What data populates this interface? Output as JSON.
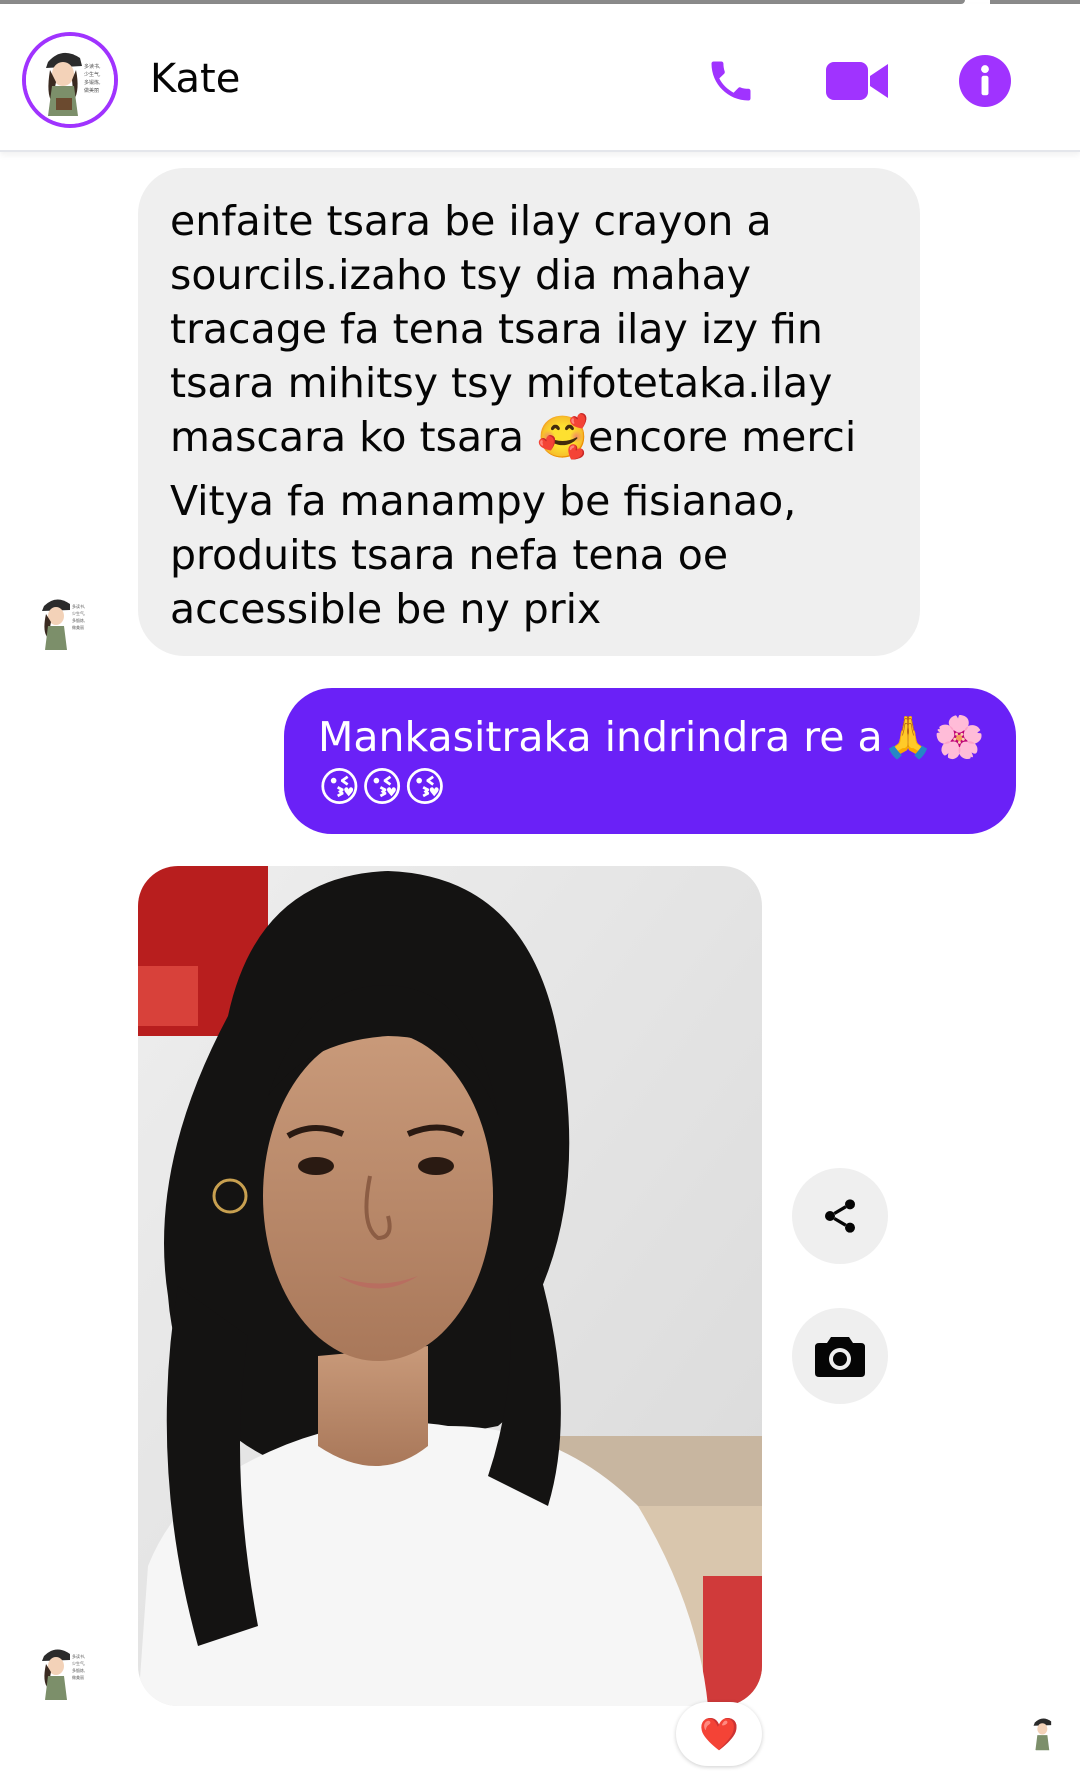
{
  "header": {
    "contact_name": "Kate",
    "avatar_icon": "cartoon-girl-avatar",
    "call_icon": "phone-icon",
    "video_icon": "video-camera-icon",
    "info_icon": "info-icon",
    "accent_color": "#a033ff"
  },
  "messages": [
    {
      "direction": "incoming",
      "paragraphs": [
        "enfaite tsara be ilay crayon a\nsourcils.izaho tsy dia mahay\ntracage fa tena tsara ilay izy fin\ntsara mihitsy tsy mifotetaka.ilay\nmascara ko tsara 🥰encore merci",
        "Vitya fa manampy be fisianao,\nproduits tsara nefa tena oe\naccessible be ny prix"
      ]
    },
    {
      "direction": "outgoing",
      "text_line1": "Mankasitraka indrindra re a🙏🌸",
      "text_line2": "😘😘😘",
      "bubble_color": "#6a21f7"
    },
    {
      "direction": "incoming",
      "type": "photo",
      "photo_subject": "selfie of a woman with curly black hair in a white t-shirt",
      "reaction": "❤️"
    }
  ],
  "actions": {
    "share_icon": "share-icon",
    "camera_icon": "camera-icon"
  }
}
